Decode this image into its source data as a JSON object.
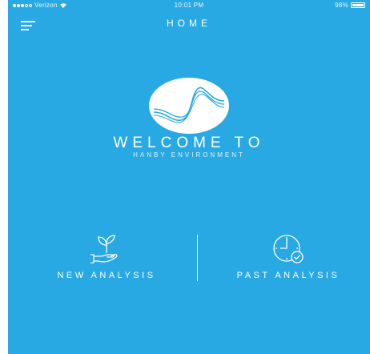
{
  "status_bar": {
    "carrier": "Verizon",
    "time": "10:01 PM",
    "battery": "98%"
  },
  "nav": {
    "title": "HOME"
  },
  "hero": {
    "welcome": "WELCOME TO",
    "company": "HANBY ENVIRONMENT"
  },
  "actions": {
    "new_analysis": "NEW ANALYSIS",
    "past_analysis": "PAST ANALYSIS"
  },
  "colors": {
    "background": "#29a9e3",
    "foreground": "#ffffff"
  }
}
